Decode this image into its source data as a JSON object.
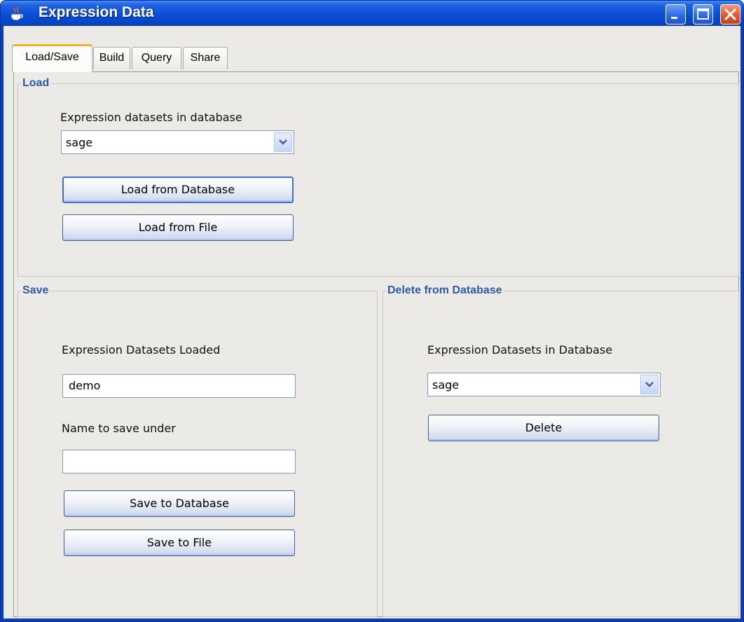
{
  "window": {
    "title": "Expression Data",
    "title_icon": "java-cup-icon",
    "controls": [
      "minimize-icon",
      "maximize-icon",
      "close-icon"
    ]
  },
  "tabs": [
    {
      "label": "Load/Save",
      "active": true
    },
    {
      "label": "Build",
      "active": false
    },
    {
      "label": "Query",
      "active": false
    },
    {
      "label": "Share",
      "active": false
    }
  ],
  "load": {
    "title": "Load",
    "datasets_label": "Expression datasets in database",
    "dataset_selected": "sage",
    "load_db_button": "Load from Database",
    "load_file_button": "Load from File"
  },
  "save": {
    "title": "Save",
    "loaded_label": "Expression Datasets Loaded",
    "loaded_value": "demo",
    "name_label": "Name to save under",
    "name_value": "",
    "save_db_button": "Save to Database",
    "save_file_button": "Save to File"
  },
  "delete": {
    "title": "Delete from Database",
    "datasets_label": "Expression Datasets in Database",
    "dataset_selected": "sage",
    "delete_button": "Delete"
  },
  "colors": {
    "titlebar": "#0b4fd4",
    "group_title": "#2d5aa8",
    "active_tab_accent": "#f5b12c",
    "panel_bg": "#eceae6"
  }
}
